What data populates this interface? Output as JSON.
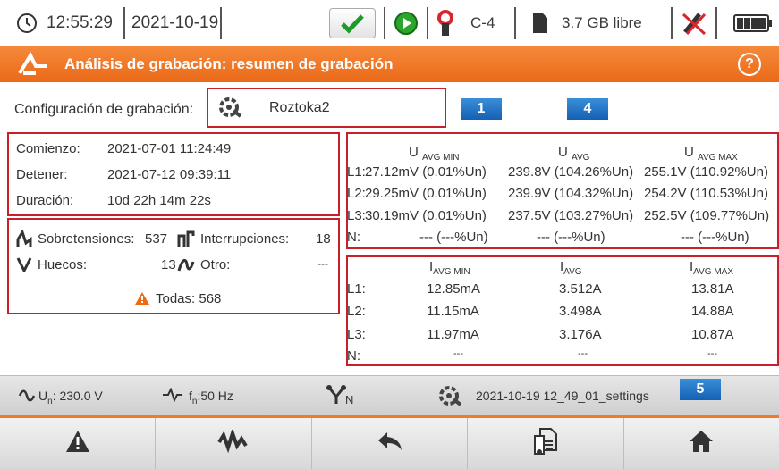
{
  "status": {
    "time": "12:55:29",
    "date": "2021-10-19",
    "channel": "C-4",
    "storage": "3.7 GB libre"
  },
  "title": "Análisis de grabación: resumen de grabación",
  "config": {
    "label": "Configuración de grabación:",
    "value": "Roztoka2"
  },
  "callouts": [
    "1",
    "4",
    "5"
  ],
  "times": [
    {
      "label": "Comienzo:",
      "value": "2021-07-01 11:24:49"
    },
    {
      "label": "Detener:",
      "value": "2021-07-12 09:39:11"
    },
    {
      "label": "Duración:",
      "value": "10d 22h 14m 22s"
    }
  ],
  "events": {
    "overvoltage_label": "Sobretensiones:",
    "overvoltage_count": "537",
    "interruption_label": "Interrupciones:",
    "interruption_count": "18",
    "dip_label": "Huecos:",
    "dip_count": "13",
    "other_label": "Otro:",
    "other_count": "---",
    "total_label": "Todas: 568"
  },
  "voltage": {
    "headers": [
      {
        "main": "U",
        "sub": "AVG MIN"
      },
      {
        "main": "U",
        "sub": "AVG"
      },
      {
        "main": "U",
        "sub": "AVG MAX"
      }
    ],
    "rows": [
      {
        "phase": "L1:",
        "min": "27.12mV (0.01%Un)",
        "avg": "239.8V (104.26%Un)",
        "max": "255.1V (110.92%Un)"
      },
      {
        "phase": "L2:",
        "min": "29.25mV (0.01%Un)",
        "avg": "239.9V (104.32%Un)",
        "max": "254.2V (110.53%Un)"
      },
      {
        "phase": "L3:",
        "min": "30.19mV (0.01%Un)",
        "avg": "237.5V (103.27%Un)",
        "max": "252.5V (109.77%Un)"
      },
      {
        "phase": "N:",
        "min": "--- (---%Un)",
        "avg": "--- (---%Un)",
        "max": "--- (---%Un)"
      }
    ]
  },
  "current": {
    "headers": [
      {
        "main": "I",
        "sub": "AVG MIN"
      },
      {
        "main": "I",
        "sub": "AVG"
      },
      {
        "main": "I",
        "sub": "AVG MAX"
      }
    ],
    "rows": [
      {
        "phase": "L1:",
        "min": "12.85mA",
        "avg": "3.512A",
        "max": "13.81A"
      },
      {
        "phase": "L2:",
        "min": "11.15mA",
        "avg": "3.498A",
        "max": "14.88A"
      },
      {
        "phase": "L3:",
        "min": "11.97mA",
        "avg": "3.176A",
        "max": "10.87A"
      },
      {
        "phase": "N:",
        "min": "---",
        "avg": "---",
        "max": "---"
      }
    ]
  },
  "infobar": {
    "un_prefix": "U",
    "un_sub": "n",
    "un_value": ": 230.0 V",
    "fn_prefix": "f",
    "fn_sub": "n",
    "fn_value": ":50 Hz",
    "settings_file": "2021-10-19 12_49_01_settings"
  },
  "accent_color": "#ee7a2a",
  "highlight_color": "#c8202a",
  "callout_color": "#1f6fc4"
}
